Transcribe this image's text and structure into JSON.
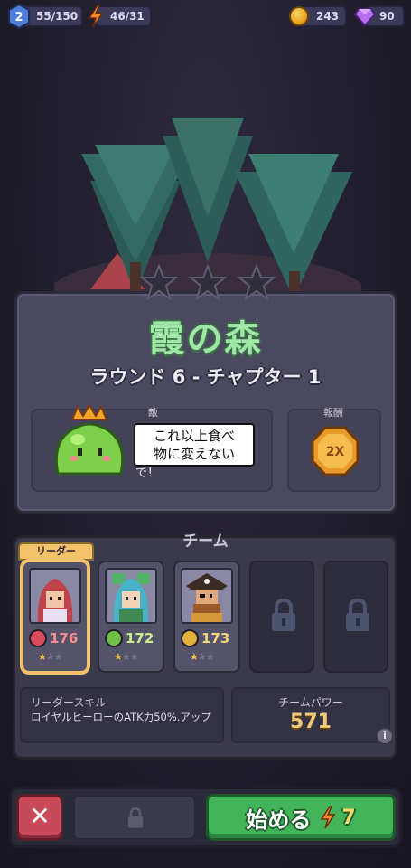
{
  "top_bar": {
    "level": "2",
    "xp": "55/150",
    "energy": "46/31",
    "coins": "243",
    "gems": "90"
  },
  "stage": {
    "title": "霞の森",
    "subtitle": "ラウンド 6 - チャプター 1",
    "stars_earned": 0,
    "stars_total": 3,
    "enemy_label": "敵",
    "enemy_speech_line1": "これ以上食べ",
    "enemy_speech_line2": "物に変えない",
    "enemy_speech_extra": "で！",
    "reward_label": "報酬",
    "reward_badge": "2X"
  },
  "team": {
    "label": "チーム",
    "leader_tag": "リーダー",
    "members": [
      {
        "name": "red-hair-hero",
        "atk": "176",
        "atk_color": "#d94b5a",
        "stars": 1
      },
      {
        "name": "blue-hair-healer",
        "atk": "172",
        "atk_color": "#6fbf47",
        "stars": 1
      },
      {
        "name": "pirate-captain",
        "atk": "173",
        "atk_color": "#e0b23a",
        "stars": 1
      }
    ],
    "locked_slots": 2,
    "leader_skill_title": "リーダースキル",
    "leader_skill_desc": "ロイヤルヒーローのATK力50%.アップ",
    "power_title": "チームパワー",
    "power_value": "571",
    "info_label": "i"
  },
  "actions": {
    "close_label": "✕",
    "start_label": "始める",
    "start_cost": "7"
  },
  "colors": {
    "accent_green": "#44b45a",
    "title_green": "#9ee7a6",
    "leader_gold": "#f3c36b",
    "close_red": "#c84a58"
  }
}
